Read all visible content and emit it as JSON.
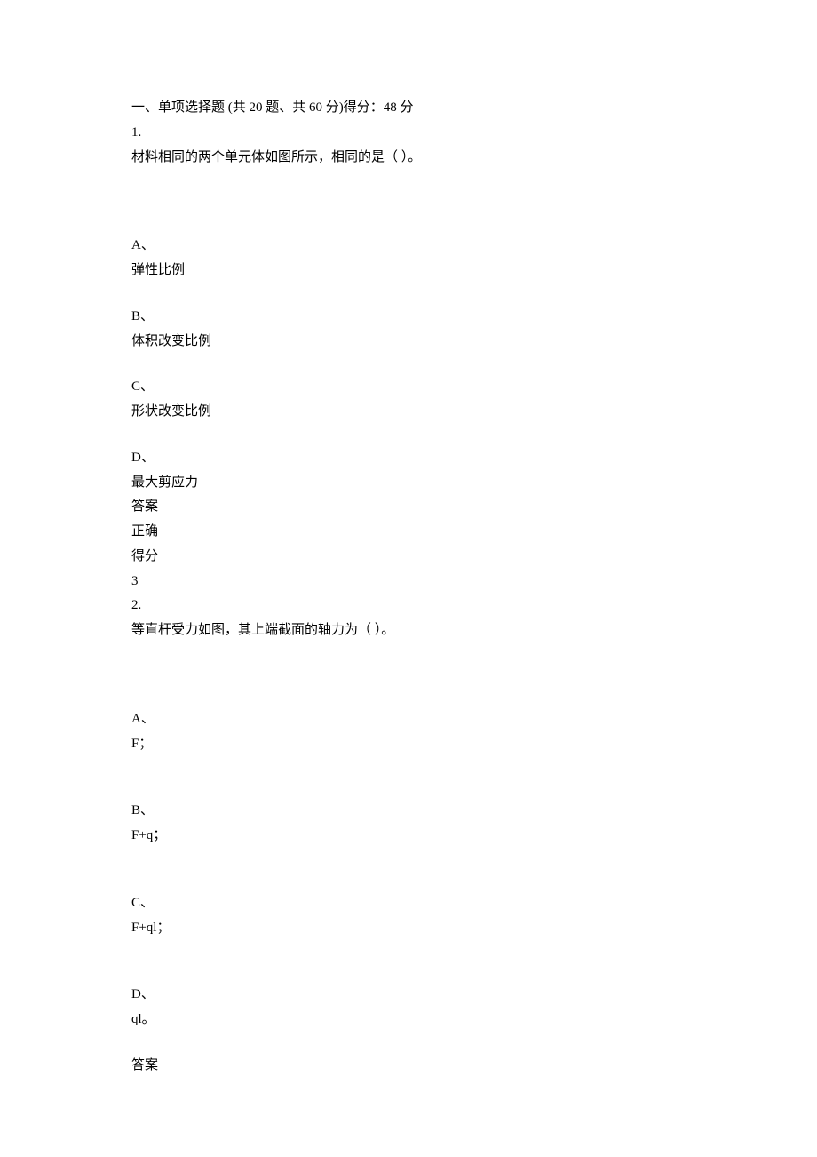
{
  "header": {
    "section_title": "一、单项选择题 (共 20 题、共 60 分)得分：48 分"
  },
  "questions": [
    {
      "number": "1.",
      "prompt": "材料相同的两个单元体如图所示，相同的是（ ）。",
      "options": [
        {
          "label": "A、",
          "text": "弹性比例"
        },
        {
          "label": "B、",
          "text": "体积改变比例"
        },
        {
          "label": "C、",
          "text": "形状改变比例"
        },
        {
          "label": "D、",
          "text": "最大剪应力"
        }
      ],
      "result": {
        "answer_label": "答案",
        "status": "正确",
        "score_label": "得分",
        "score": "3"
      }
    },
    {
      "number": "2.",
      "prompt": "等直杆受力如图，其上端截面的轴力为（ ）。",
      "options": [
        {
          "label": "A、",
          "text": "F；"
        },
        {
          "label": "B、",
          "text": "F+q；"
        },
        {
          "label": "C、",
          "text": "F+ql；"
        },
        {
          "label": "D、",
          "text": "ql。"
        }
      ],
      "result": {
        "answer_label": "答案"
      }
    }
  ]
}
